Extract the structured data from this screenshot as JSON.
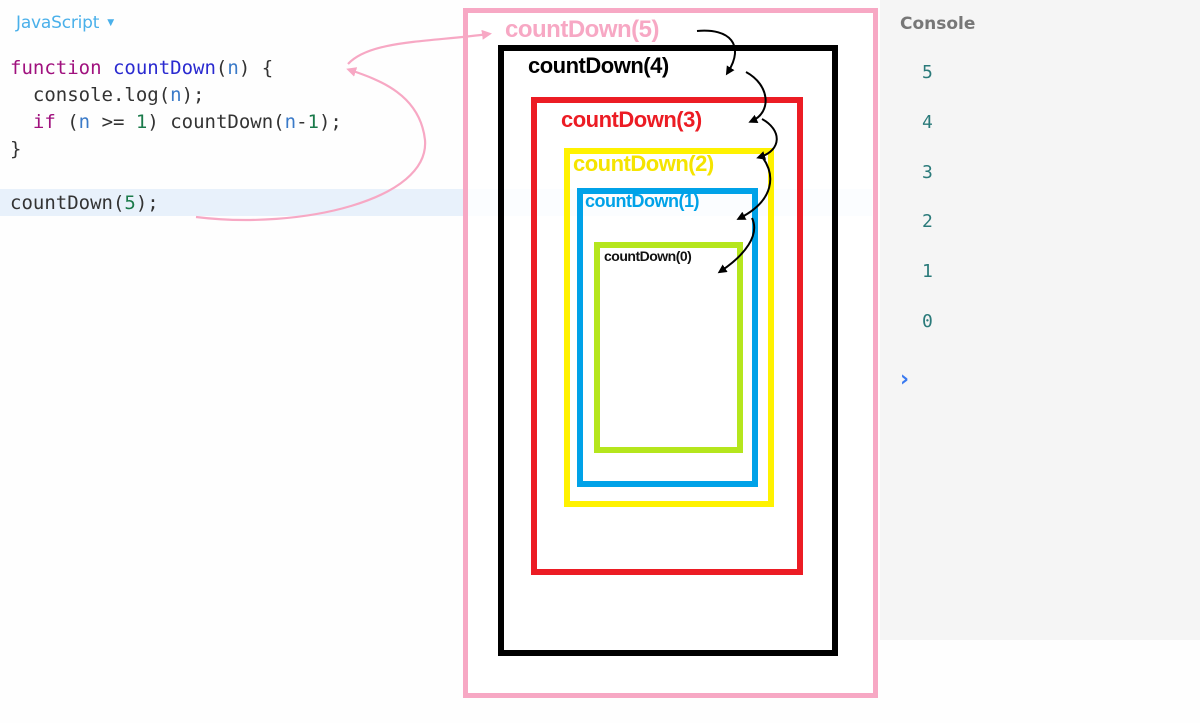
{
  "editor": {
    "language": "JavaScript",
    "language_caret": "▼",
    "highlighted_line": 6,
    "lines": [
      [
        {
          "t": "function",
          "c": "kw"
        },
        {
          "t": " ",
          "c": "plain"
        },
        {
          "t": "countDown",
          "c": "fn"
        },
        {
          "t": "(",
          "c": "plain"
        },
        {
          "t": "n",
          "c": "var"
        },
        {
          "t": ") {",
          "c": "plain"
        }
      ],
      [
        {
          "t": "  console.log(",
          "c": "plain"
        },
        {
          "t": "n",
          "c": "var"
        },
        {
          "t": ");",
          "c": "plain"
        }
      ],
      [
        {
          "t": "  ",
          "c": "plain"
        },
        {
          "t": "if",
          "c": "kw"
        },
        {
          "t": " (",
          "c": "plain"
        },
        {
          "t": "n",
          "c": "var"
        },
        {
          "t": " >= ",
          "c": "plain"
        },
        {
          "t": "1",
          "c": "num"
        },
        {
          "t": ") countDown(",
          "c": "plain"
        },
        {
          "t": "n",
          "c": "var"
        },
        {
          "t": "-",
          "c": "plain"
        },
        {
          "t": "1",
          "c": "num"
        },
        {
          "t": ");",
          "c": "plain"
        }
      ],
      [
        {
          "t": "}",
          "c": "plain"
        }
      ],
      [],
      [
        {
          "t": "countDown(",
          "c": "plain"
        },
        {
          "t": "5",
          "c": "num"
        },
        {
          "t": ");",
          "c": "plain"
        }
      ]
    ]
  },
  "console": {
    "title": "Console",
    "output": [
      "5",
      "4",
      "3",
      "2",
      "1",
      "0"
    ],
    "prompt": "›"
  },
  "call_stack": {
    "frames": [
      {
        "label": "countDown(5)",
        "color": "#f7a8c4"
      },
      {
        "label": "countDown(4)",
        "color": "#000000"
      },
      {
        "label": "countDown(3)",
        "color": "#ec1c24"
      },
      {
        "label": "countDown(2)",
        "color": "#fff200"
      },
      {
        "label": "countDown(1)",
        "color": "#00a2e8"
      },
      {
        "label": "countDown(0)",
        "color": "#b5e61d"
      }
    ],
    "annotation_colors": {
      "pink_arrow": "#f7a8c4",
      "black_arrow": "#000000"
    }
  }
}
